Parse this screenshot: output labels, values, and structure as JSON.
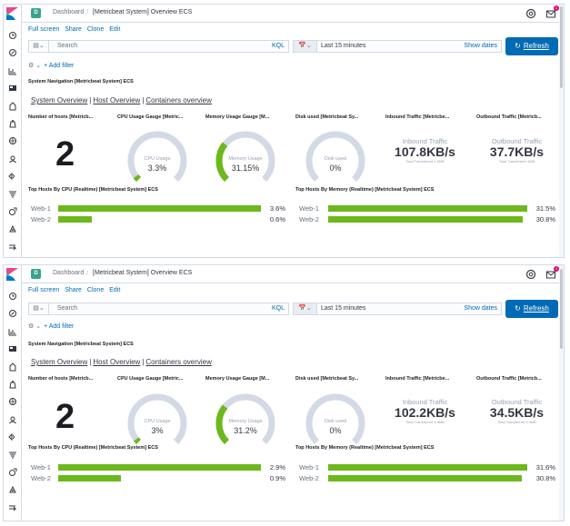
{
  "nav": {
    "breadcrumb_root": "Dashboard",
    "breadcrumb_separator": "/",
    "space_initial": "D",
    "mail_badge": "1"
  },
  "menu": {
    "full_screen": "Full screen",
    "share": "Share",
    "clone": "Clone",
    "edit": "Edit"
  },
  "query": {
    "placeholder": "Search",
    "language": "KQL"
  },
  "time": {
    "label": "Last 15 minutes",
    "show_dates": "Show dates"
  },
  "refresh_label": "Refresh",
  "add_filter": "+ Add filter",
  "system_nav": {
    "title": "System Navigation [Metricbeat System] ECS",
    "links": [
      "System Overview",
      "Host Overview",
      "Containers overview"
    ],
    "separator": "|"
  },
  "vis_titles": {
    "hosts": "Number of hosts [Metricb...",
    "cpu": "CPU Usage Gauge [Metric...",
    "memory": "Memory Usage Gauge [M...",
    "disk": "Disk used [Metricbeat Sy...",
    "inbound": "Inbound Traffic [Metricbe...",
    "outbound": "Outbound Traffic [Metricb...",
    "top_cpu": "Top Hosts By CPU (Realtime) [Metricbeat System] ECS",
    "top_mem": "Top Hosts By Memory (Realtime) [Metricbeat System] ECS"
  },
  "gauge_labels": {
    "cpu": "CPU Usage",
    "memory": "Memory Usage",
    "disk": "Disk used"
  },
  "traffic_labels": {
    "inbound": "Inbound Traffic",
    "outbound": "Outbound Traffic"
  },
  "colors": {
    "accent": "#006bb4",
    "bar": "#6cb81d",
    "gauge_track": "#d3dae6"
  },
  "screens": [
    {
      "title": "[Metricbeat System] Overview ECS",
      "hosts": "2",
      "cpu": {
        "text": "3.3%",
        "fraction": 0.033
      },
      "memory": {
        "text": "31.15%",
        "fraction": 0.3115
      },
      "disk": {
        "text": "0%",
        "fraction": 0
      },
      "inbound": {
        "value": "107.8KB/s",
        "sub": "Total Transferred 1.8MB"
      },
      "outbound": {
        "value": "37.7KB/s",
        "sub": "Total Transferred 1MB"
      },
      "top_cpu": [
        {
          "label": "Web-1",
          "text": "3.6%",
          "value": 3.6
        },
        {
          "label": "Web-2",
          "text": "0.6%",
          "value": 0.6
        }
      ],
      "top_mem": [
        {
          "label": "Web-1",
          "text": "31.5%",
          "value": 31.5
        },
        {
          "label": "Web-2",
          "text": "30.8%",
          "value": 30.8
        }
      ]
    },
    {
      "title": "[Metricbeat System] Overview ECS",
      "hosts": "2",
      "cpu": {
        "text": "3%",
        "fraction": 0.03
      },
      "memory": {
        "text": "31.2%",
        "fraction": 0.312
      },
      "disk": {
        "text": "0%",
        "fraction": 0
      },
      "inbound": {
        "value": "102.2KB/s",
        "sub": "Total Transferred 9.8MB"
      },
      "outbound": {
        "value": "34.5KB/s",
        "sub": "Total Transferred 3.4MB"
      },
      "top_cpu": [
        {
          "label": "Web-1",
          "text": "2.9%",
          "value": 2.9
        },
        {
          "label": "Web-2",
          "text": "0.9%",
          "value": 0.9
        }
      ],
      "top_mem": [
        {
          "label": "Web-1",
          "text": "31.6%",
          "value": 31.6
        },
        {
          "label": "Web-2",
          "text": "30.8%",
          "value": 30.8
        }
      ]
    }
  ]
}
